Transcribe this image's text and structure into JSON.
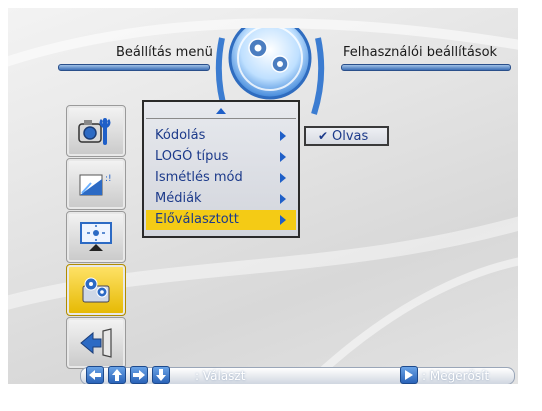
{
  "header": {
    "left_title": "Beállítás menü",
    "right_title": "Felhasználói beállítások"
  },
  "sidebar": {
    "items": [
      {
        "icon": "camera-settings-icon"
      },
      {
        "icon": "projector-icon"
      },
      {
        "icon": "screen-icon"
      },
      {
        "icon": "gear-settings-icon",
        "active": true
      },
      {
        "icon": "exit-door-icon"
      }
    ]
  },
  "menu": {
    "items": [
      {
        "label": "Kódolás"
      },
      {
        "label": "LOGÓ típus"
      },
      {
        "label": "Ismétlés mód"
      },
      {
        "label": "Médiák"
      },
      {
        "label": "Előválasztott",
        "selected": true
      }
    ]
  },
  "submenu": {
    "check": "✔",
    "value": "Olvas"
  },
  "footer": {
    "select_label": ": Választ",
    "confirm_label": ": Megerősít"
  },
  "colors": {
    "accent_blue": "#1f5fc8",
    "highlight_yellow": "#f4cb15",
    "text_blue": "#1c3a8a"
  }
}
